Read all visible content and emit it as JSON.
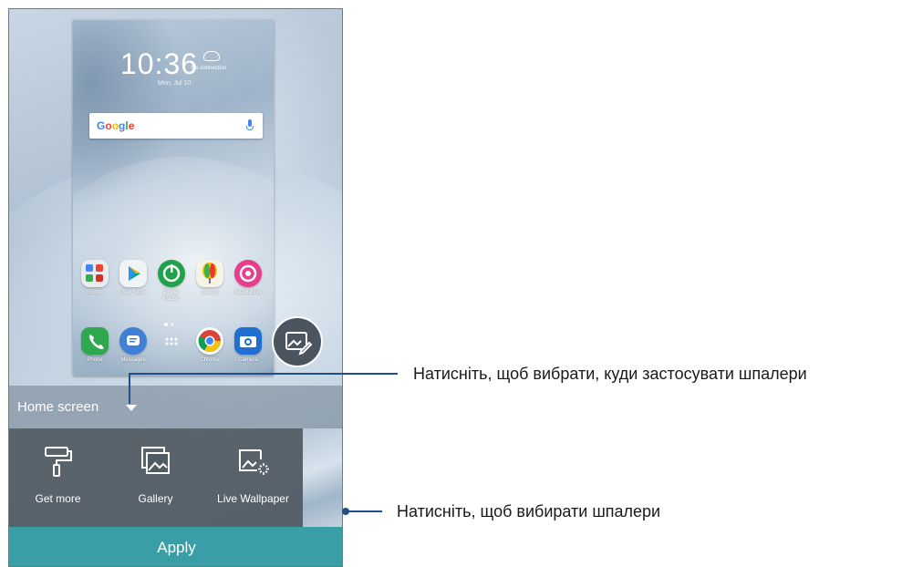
{
  "lockscreen": {
    "time": "10:36",
    "weather": "No connection",
    "date": "Mon, Jul 10",
    "search_brand": "Google"
  },
  "apps_row1": [
    {
      "label": "Google",
      "icon": "google-folder-icon"
    },
    {
      "label": "Play Store",
      "icon": "play-store-icon"
    },
    {
      "label": "Power Master",
      "icon": "power-master-icon"
    },
    {
      "label": "Gallery",
      "icon": "gallery-app-icon"
    },
    {
      "label": "BeautyLive",
      "icon": "beautylive-icon"
    }
  ],
  "apps_row2": [
    {
      "label": "Phone",
      "icon": "phone-icon"
    },
    {
      "label": "Messages",
      "icon": "messages-icon"
    },
    {
      "label": "",
      "icon": "app-drawer-icon"
    },
    {
      "label": "Chrome",
      "icon": "chrome-icon"
    },
    {
      "label": "Camera",
      "icon": "camera-icon"
    }
  ],
  "apply_to": {
    "selected": "Home screen"
  },
  "pickers": [
    {
      "label": "Get more",
      "icon": "paint-roller-icon"
    },
    {
      "label": "Gallery",
      "icon": "gallery-icon"
    },
    {
      "label": "Live Wallpaper",
      "icon": "live-wallpaper-icon"
    }
  ],
  "apply_button": "Apply",
  "callouts": {
    "top": "Натисніть, щоб вибрати, куди застосувати шпалери",
    "bottom": "Натисніть, щоб вибирати шпалери"
  },
  "colors": {
    "accent": "#3a9ea7",
    "callout_line": "#1f4e8c"
  }
}
